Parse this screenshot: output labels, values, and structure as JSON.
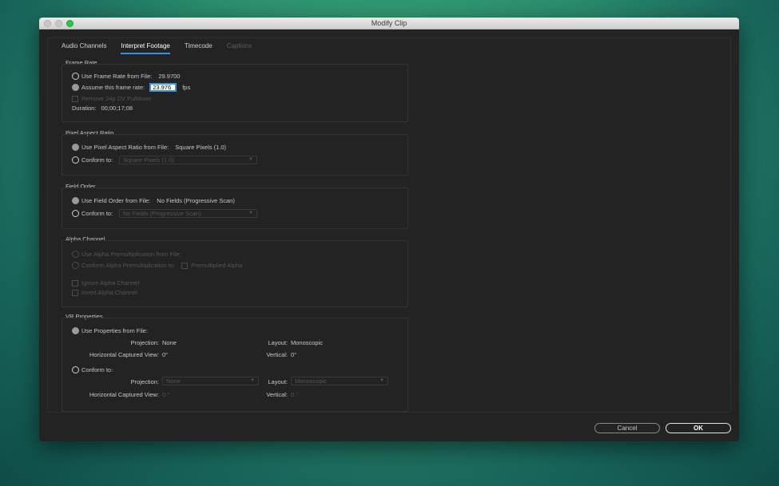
{
  "window": {
    "title": "Modify Clip"
  },
  "tabs": [
    {
      "label": "Audio Channels",
      "state": "normal"
    },
    {
      "label": "Interpret Footage",
      "state": "active"
    },
    {
      "label": "Timecode",
      "state": "normal"
    },
    {
      "label": "Captions",
      "state": "disabled"
    }
  ],
  "frame_rate": {
    "heading": "Frame Rate",
    "use_file_label": "Use Frame Rate from File:",
    "use_file_value": "29.9700",
    "assume_label": "Assume this frame rate:",
    "assume_value": "23.976",
    "assume_unit": "fps",
    "pulldown_label": "Remove 24p DV Pulldown",
    "duration_label": "Duration:",
    "duration_value": "00;00;17;08"
  },
  "pixel_aspect": {
    "heading": "Pixel Aspect Ratio",
    "use_file_label": "Use Pixel Aspect Ratio from File:",
    "use_file_value": "Square Pixels (1.0)",
    "conform_label": "Conform to:",
    "conform_value": "Square Pixels (1.0)"
  },
  "field_order": {
    "heading": "Field Order",
    "use_file_label": "Use Field Order from File:",
    "use_file_value": "No Fields (Progressive Scan)",
    "conform_label": "Conform to:",
    "conform_value": "No Fields (Progressive Scan)"
  },
  "alpha": {
    "heading": "Alpha Channel",
    "use_file_label": "Use Alpha Premultiplication from File:",
    "conform_label": "Conform Alpha Premultiplication to:",
    "premult_label": "Premultiplied Alpha",
    "ignore_label": "Ignore Alpha Channel",
    "invert_label": "Invert Alpha Channel"
  },
  "vr": {
    "heading": "VR Properties",
    "use_file_label": "Use Properties from File:",
    "projection_label": "Projection:",
    "projection_value": "None",
    "layout_label": "Layout:",
    "layout_value": "Monoscopic",
    "hview_label": "Horizontal Captured View:",
    "hview_value": "0°",
    "vertical_label": "Vertical:",
    "vertical_value": "0°",
    "conform_label": "Conform to:",
    "c_projection_value": "None",
    "c_layout_value": "Monoscopic",
    "c_hview_value": "0 °",
    "c_vertical_value": "0 °"
  },
  "buttons": {
    "cancel": "Cancel",
    "ok": "OK"
  },
  "colors": {
    "accent": "#3b8fe6",
    "dialog_bg": "#232323",
    "window_max": "#27c93f"
  }
}
